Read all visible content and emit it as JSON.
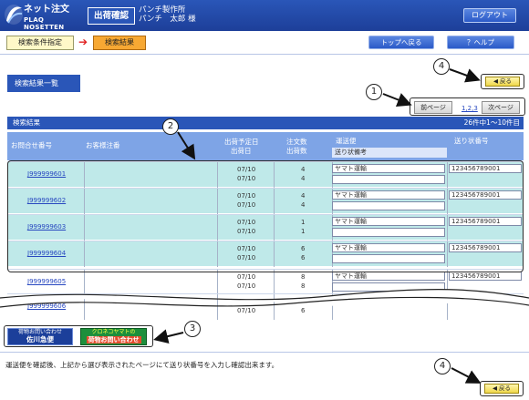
{
  "header": {
    "logo_line1": "ネット注文",
    "logo_line2": "PLAQ NOSETTEN",
    "page_name": "出荷確認",
    "company": "パンチ製作所",
    "user": "パンチ　太郎 様",
    "logout": "ログアウト"
  },
  "breadcrumb": {
    "step1": "検索条件指定",
    "arrow": "➔",
    "step2": "検索結果"
  },
  "toolbar": {
    "top_back": "トップへ戻る",
    "help": "？ヘルプ"
  },
  "results": {
    "section_title": "検索結果一覧",
    "back_label": "◀ 戻る",
    "prev_page": "前ページ",
    "pages": "1,2,3",
    "next_page": "次ページ",
    "table_title": "検索結果",
    "count_text": "26件中1〜10件目"
  },
  "columns": {
    "inquiry_no": "お問合せ番号",
    "customer_note": "お客様注番",
    "ship_date_top": "出荷予定日",
    "ship_date_bottom": "出荷日",
    "qty_top": "注文数",
    "qty_bottom": "出荷数",
    "carrier_top": "運送便",
    "carrier_bottom": "送り状備考",
    "tracking": "送り状番号"
  },
  "rows": [
    {
      "inquiry": "J999999601",
      "note": "",
      "date1": "07/10",
      "date2": "07/10",
      "q1": "4",
      "q2": "4",
      "carrier": "ヤマト運輸",
      "tracking": "123456789001"
    },
    {
      "inquiry": "J999999602",
      "note": "",
      "date1": "07/10",
      "date2": "07/10",
      "q1": "4",
      "q2": "4",
      "carrier": "ヤマト運輸",
      "tracking": "123456789001"
    },
    {
      "inquiry": "J999999603",
      "note": "",
      "date1": "07/10",
      "date2": "07/10",
      "q1": "1",
      "q2": "1",
      "carrier": "ヤマト運輸",
      "tracking": "123456789001"
    },
    {
      "inquiry": "J999999604",
      "note": "",
      "date1": "07/10",
      "date2": "07/10",
      "q1": "6",
      "q2": "6",
      "carrier": "ヤマト運輸",
      "tracking": "123456789001"
    },
    {
      "inquiry": "J999999605",
      "note": "",
      "date1": "07/10",
      "date2": "07/10",
      "q1": "8",
      "q2": "8",
      "carrier": "ヤマト運輸",
      "tracking": "123456789001"
    },
    {
      "inquiry": "J999999606",
      "note": "",
      "date1": "",
      "date2": "07/10",
      "q1": "",
      "q2": "6",
      "carrier": "",
      "tracking": ""
    }
  ],
  "callouts": {
    "c1": "1",
    "c2": "2",
    "c3": "3",
    "c4": "4",
    "c4b": "4"
  },
  "carriers": {
    "sagawa_top": "荷物お問い合わせ",
    "sagawa_name": "佐川急便",
    "yamato_top": "クロネコヤマトの",
    "yamato_name": "荷物お問い合わせ"
  },
  "footer": {
    "note": "運送便を確認後、上記から選び表示されたページにて送り状番号を入力し確認出来ます。",
    "back_label": "◀ 戻る"
  },
  "colors": {
    "header_blue": "#2a56b8",
    "highlight_cyan": "#bfe9e9",
    "breadcrumb_active": "#f7a833",
    "back_yellow": "#f0d84a"
  }
}
